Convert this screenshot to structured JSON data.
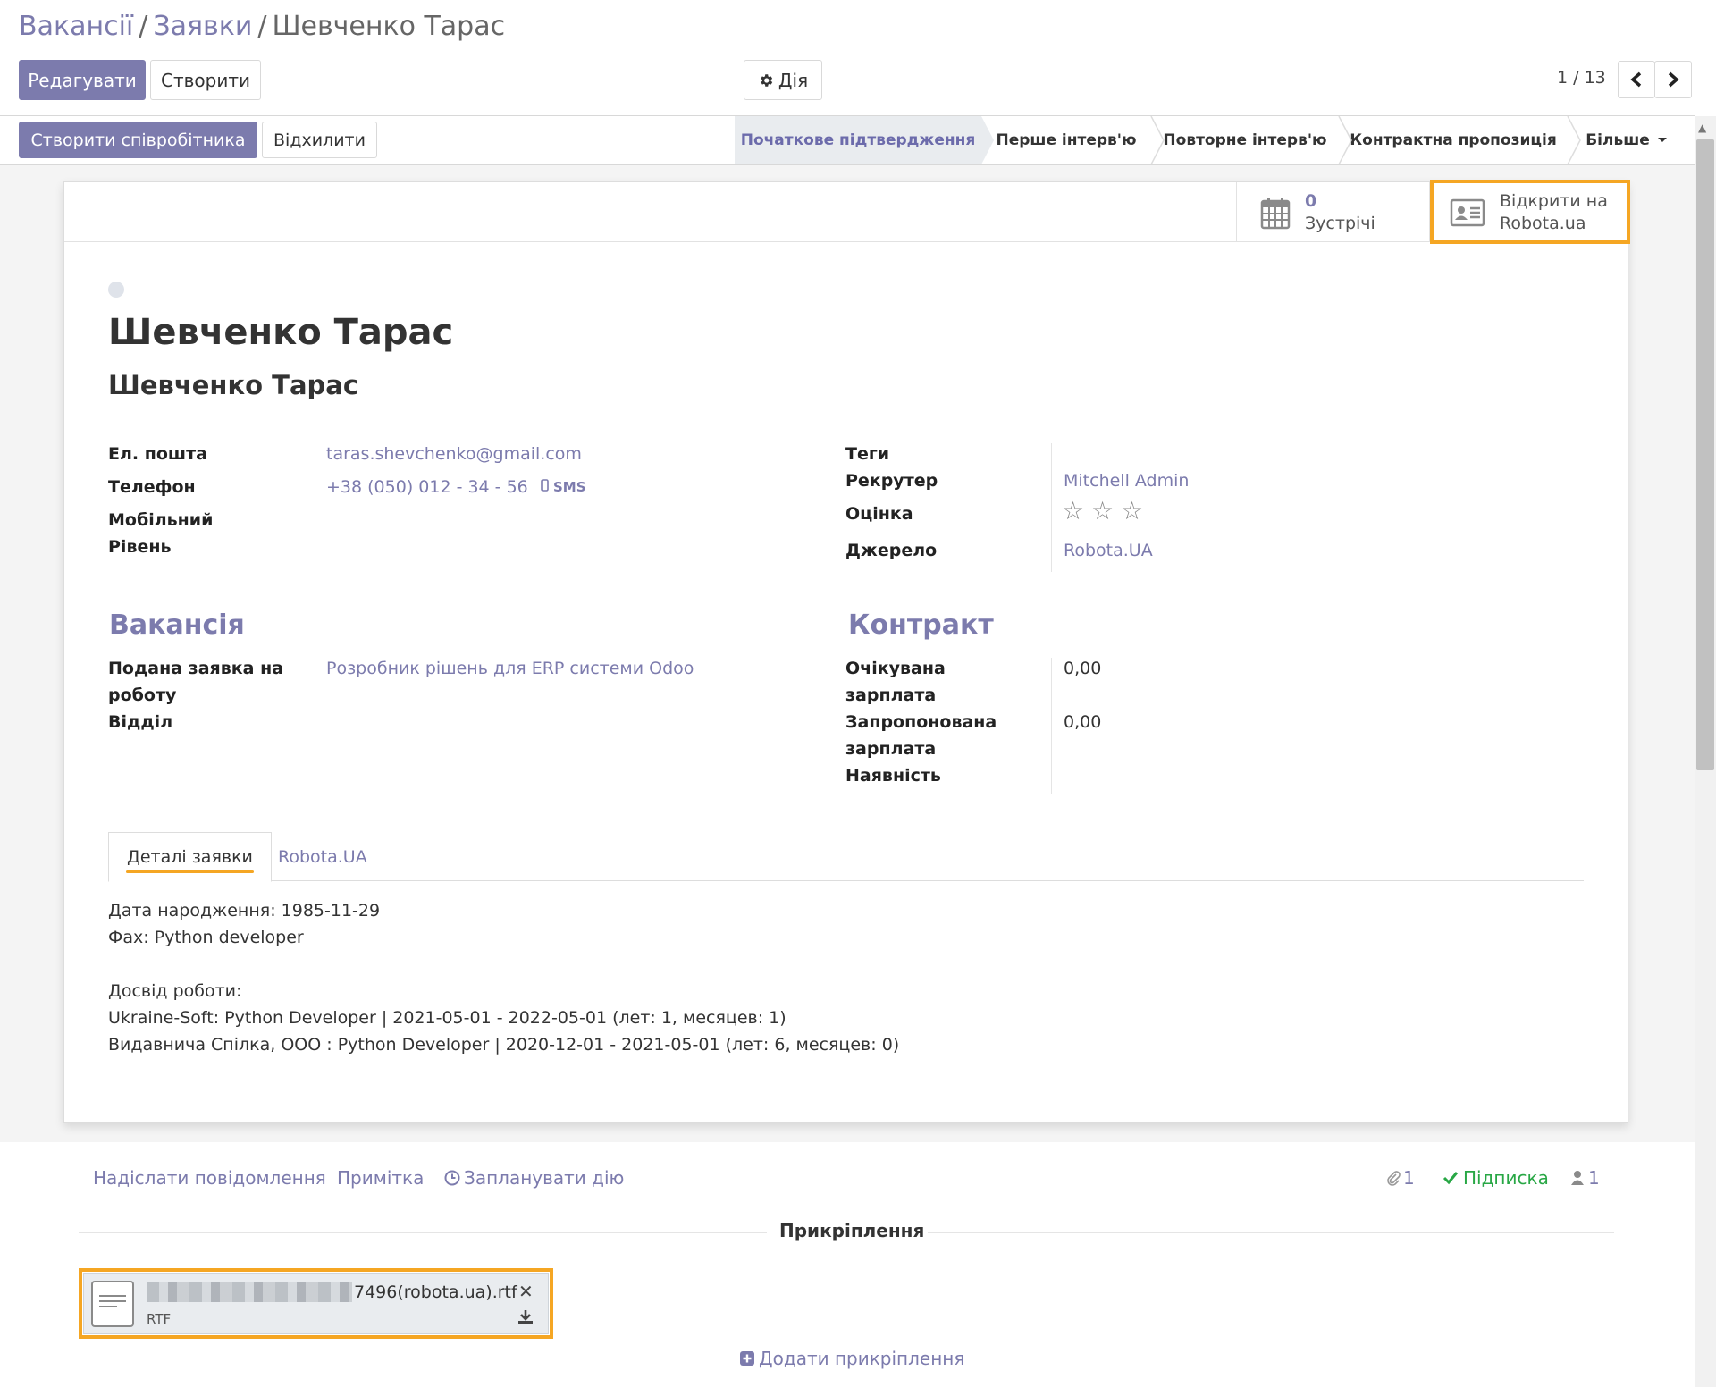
{
  "breadcrumb": {
    "items": [
      "Вакансії",
      "Заявки"
    ],
    "current": "Шевченко Тарас",
    "separator": "/"
  },
  "toolbar": {
    "edit_label": "Редагувати",
    "create_label": "Створити",
    "action_label": "Дія",
    "pager_value": "1 / 13"
  },
  "statusbar": {
    "create_employee_label": "Створити співробітника",
    "refuse_label": "Відхилити",
    "stages": [
      "Початкове підтвердження",
      "Перше інтерв'ю",
      "Повторне інтерв'ю",
      "Контрактна пропозиція"
    ],
    "current_stage": "Початкове підтвердження",
    "more_label": "Більше"
  },
  "smart_buttons": {
    "meetings": {
      "count": "0",
      "label": "Зустрічі"
    },
    "robota": {
      "line1": "Відкрити на",
      "line2": "Robota.ua"
    }
  },
  "record": {
    "name": "Шевченко Тарас",
    "partner_name": "Шевченко Тарас"
  },
  "fields_left": {
    "email_label": "Ел. пошта",
    "email_value": "taras.shevchenko@gmail.com",
    "phone_label": "Телефон",
    "phone_value": "+38 (050) 012 - 34 - 56",
    "sms_label": "SMS",
    "mobile_label": "Мобільний",
    "level_label": "Рівень"
  },
  "fields_right": {
    "tags_label": "Теги",
    "recruiter_label": "Рекрутер",
    "recruiter_value": "Mitchell Admin",
    "rating_label": "Оцінка",
    "rating_value": 0,
    "rating_max": 3,
    "source_label": "Джерело",
    "source_value": "Robota.UA"
  },
  "job_section": {
    "title": "Вакансія",
    "applied_label_1": "Подана заявка на",
    "applied_label_2": "роботу",
    "applied_value": "Розробник рішень для ERP системи Odoo",
    "department_label": "Відділ"
  },
  "contract_section": {
    "title": "Контракт",
    "expected_label_1": "Очікувана",
    "expected_label_2": "зарплата",
    "expected_value": "0,00",
    "proposed_label_1": "Запропонована",
    "proposed_label_2": "зарплата",
    "proposed_value": "0,00",
    "availability_label": "Наявність"
  },
  "tabs": [
    {
      "label": "Деталі заявки",
      "active": true
    },
    {
      "label": "Robota.UA",
      "active": false
    }
  ],
  "description": {
    "line1": "Дата народження: 1985-11-29",
    "line2": "Фах: Python developer",
    "line3": "Досвід роботи:",
    "line4": "Ukraine-Soft: Python Developer | 2021-05-01 - 2022-05-01 (лет: 1, месяцев: 1)",
    "line5": "Видавнича Спілка, ООО : Python Developer | 2020-12-01 - 2021-05-01 (лет: 6, месяцев: 0)"
  },
  "chatter": {
    "send_message": "Надіслати повідомлення",
    "log_note": "Примітка",
    "schedule_activity": "Запланувати дію",
    "attachment_count": "1",
    "follow_label": "Підписка",
    "follower_count": "1",
    "attachments_title": "Прикріплення",
    "attachment": {
      "name_suffix": "7496(robota.ua).rtf",
      "ext": "RTF"
    },
    "add_attachment": "Додати прикріплення"
  },
  "colors": {
    "brand": "#7c7bad",
    "highlight": "#f5a623",
    "success": "#28a745"
  }
}
